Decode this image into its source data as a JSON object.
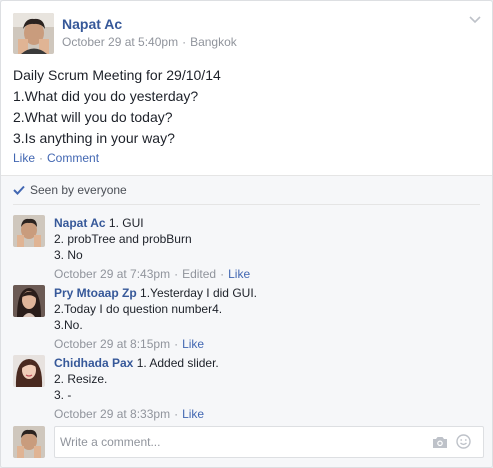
{
  "post": {
    "author": "Napat Ac",
    "date": "October 29 at 5:40pm",
    "separator": "·",
    "location": "Bangkok",
    "lines": [
      "Daily Scrum Meeting for 29/10/14",
      "1.What did you do yesterday?",
      "2.What will you do today?",
      "3.Is anything in your way?"
    ],
    "like_label": "Like",
    "comment_label": "Comment"
  },
  "seen": {
    "label": "Seen by everyone"
  },
  "comments": [
    {
      "author": "Napat Ac",
      "first_line": "1. GUI",
      "more_lines": [
        "2. probTree and probBurn",
        "3. No"
      ],
      "time": "October 29 at 7:43pm",
      "edited": "Edited",
      "like": "Like"
    },
    {
      "author": "Pry Mtoaap Zp",
      "first_line": "1.Yesterday I did GUI.",
      "more_lines": [
        "2.Today I do question number4.",
        "3.No."
      ],
      "time": "October 29 at 8:15pm",
      "like": "Like"
    },
    {
      "author": "Chidhada Pax",
      "first_line": "1. Added slider.",
      "more_lines": [
        "2. Resize.",
        "3. -"
      ],
      "time": "October 29 at 8:33pm",
      "like": "Like"
    }
  ],
  "composer": {
    "placeholder": "Write a comment..."
  },
  "icons": {
    "chevron": "chevron-down-icon",
    "check": "check-icon",
    "camera": "camera-icon",
    "emoji": "emoji-icon"
  },
  "colors": {
    "link": "#365899",
    "action": "#4267b2",
    "meta": "#90949c"
  }
}
